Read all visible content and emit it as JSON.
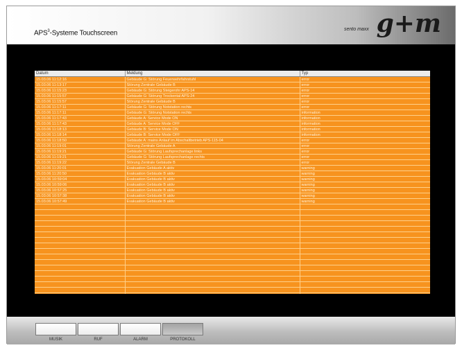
{
  "header": {
    "title_main": "APS",
    "title_sup": "3",
    "title_rest": "-Systeme Touchscreen",
    "faint_text": "",
    "brand_tagline": "sento maxx",
    "brand_logo": "g+m"
  },
  "table": {
    "columns": [
      "Datum",
      "Meldung",
      "Typ"
    ],
    "rows": [
      [
        "15.03.06 11:12:16",
        "Gebäude G: Störung Feuerwehrfahrstuhl",
        "error"
      ],
      [
        "15.03.06 11:13:17",
        "Störung Zentrale Gebäude B",
        "error"
      ],
      [
        "15.03.06 11:15:23",
        "Gebäude G: Störung Steigerohr APS-14",
        "error"
      ],
      [
        "15.03.06 11:15:57",
        "Gebäude G: Störung Trockental APS-24",
        "error"
      ],
      [
        "15.03.06 11:15:57",
        "Störung Zentrale Gebäude B",
        "error"
      ],
      [
        "15.03.06 11:17:11",
        "Gebäude G: Störung Notstation rechts",
        "error"
      ],
      [
        "15.03.06 11:17:11",
        "Gebäude G: Störung Notstation rechts",
        "information"
      ],
      [
        "15.03.06 11:17:43",
        "Gebäude A: Service Mode ON",
        "information"
      ],
      [
        "15.03.06 11:17:43",
        "Gebäude A: Service Mode OFF",
        "information"
      ],
      [
        "15.03.06 11:18:13",
        "Gebäude B: Service Mode ON",
        "information"
      ],
      [
        "15.03.06 11:18:14",
        "Gebäude B: Service Mode OFF",
        "information"
      ],
      [
        "15.03.06 11:18:50",
        "Gebäude A: mains Anlauf im Abschaltbetrieb APS-115-04",
        "error"
      ],
      [
        "15.03.06 11:19:01",
        "Störung Zentrale Gebäude A",
        "error"
      ],
      [
        "15.03.06 11:19:21",
        "Gebäude G: Störung Laufsprechanlage links",
        "error"
      ],
      [
        "15.03.06 11:19:21",
        "Gebäude G: Störung Laufsprechanlage rechts",
        "error"
      ],
      [
        "15.03.06 11:19:22",
        "Störung Zentrale Gebäude B",
        "error"
      ],
      [
        "15.03.06 11:20:01",
        "Evakuation Gebäude A aktiv",
        "warning"
      ],
      [
        "15.03.06 11:20:50",
        "Evakuation Gebäude B aktiv",
        "warning"
      ],
      [
        "15.03.06 10:59:04",
        "Evakuation Gebäude B aktiv",
        "warning"
      ],
      [
        "15.03.06 10:59:06",
        "Evakuation Gebäude B aktiv",
        "warning"
      ],
      [
        "15.03.06 10:57:25",
        "Evakuation Gebäude B aktiv",
        "warning"
      ],
      [
        "15.03.06 10:57:38",
        "Evakuation Gebäude B aktiv",
        "warning"
      ],
      [
        "15.03.06 10:57:49",
        "Evakuation Gebäude B aktiv",
        "warning"
      ]
    ],
    "empty_rows": 17
  },
  "footer": {
    "buttons": [
      {
        "label": "MUSIK",
        "active": false
      },
      {
        "label": "RUF",
        "active": false
      },
      {
        "label": "ALARM",
        "active": false
      },
      {
        "label": "PROTOKOLL",
        "active": true
      }
    ]
  },
  "colors": {
    "table_bg": "#f7931e",
    "screen_bg": "#000000"
  }
}
